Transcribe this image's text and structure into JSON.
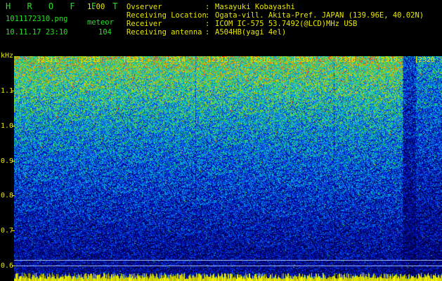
{
  "app": {
    "title": "H R O F F T",
    "version": "1.00"
  },
  "file": {
    "name": "1011172310.png",
    "timestamp": "10.11.17 23:10"
  },
  "meteor": {
    "label": "meteor",
    "count": "104"
  },
  "info": [
    {
      "key": "Ovserver",
      "sep": ":",
      "value": "Masayuki Kobayashi"
    },
    {
      "key": "Receiving Location",
      "sep": ":",
      "value": "Ogata-vill. Akita-Pref. JAPAN (139.96E, 40.02N)"
    },
    {
      "key": "Receiver",
      "sep": ":",
      "value": "ICOM IC-575 53.7492(@LCD)MHz USB"
    },
    {
      "key": "Receiving antenna",
      "sep": ":",
      "value": "A504HB(yagi 4el)"
    }
  ],
  "axis": {
    "y_label": "kHz",
    "y_ticks": [
      "1.1",
      "1.0",
      "0.9",
      "0.8",
      "0.7",
      "0.6"
    ],
    "time_labels": [
      "2311",
      "2312",
      "2313",
      "2314",
      "2315",
      "2316",
      "2317",
      "2318",
      "2319",
      "2320"
    ]
  },
  "colors": {
    "text_green": "#22e322",
    "text_yellow": "#e8e800",
    "background": "#000000"
  }
}
